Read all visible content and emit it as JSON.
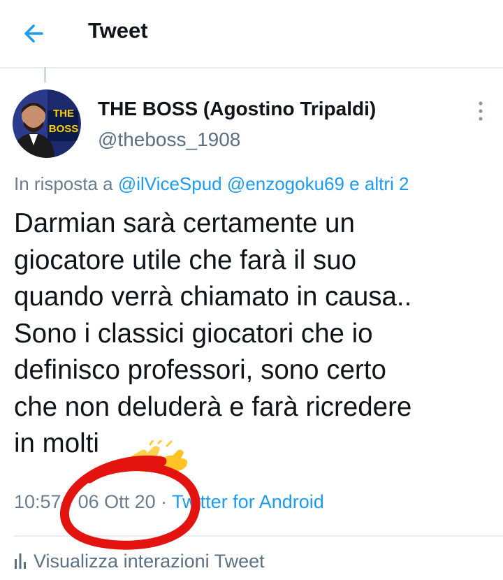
{
  "header": {
    "title": "Tweet",
    "back_icon": "arrow-left-icon"
  },
  "author": {
    "display_name": "THE BOSS (Agostino Tripaldi)",
    "handle": "@theboss_1908",
    "avatar_badge_line1": "THE",
    "avatar_badge_line2": "BOSS"
  },
  "reply": {
    "prefix": "In risposta a ",
    "mention1": "@ilViceSpud",
    "mention2": "@enzogoku69",
    "suffix": " e altri 2"
  },
  "tweet": {
    "lines": [
      "Darmian sarà certamente un",
      "giocatore utile che farà il suo",
      "quando verrà chiamato in causa..",
      "Sono i classici giocatori che io",
      "definisco professori, sono certo",
      "che non deluderà e farà ricredere",
      "in molti"
    ]
  },
  "meta": {
    "time": "10:57",
    "separator": " · ",
    "date": "06 Ott 20",
    "source": "Twitter for Android"
  },
  "footer": {
    "interactions_label": "Visualizza interazioni Tweet",
    "icon": "bar-chart-icon"
  },
  "colors": {
    "accent": "#1d9bf0",
    "muted": "#6b7d8c",
    "annotation": "#e3140f"
  }
}
